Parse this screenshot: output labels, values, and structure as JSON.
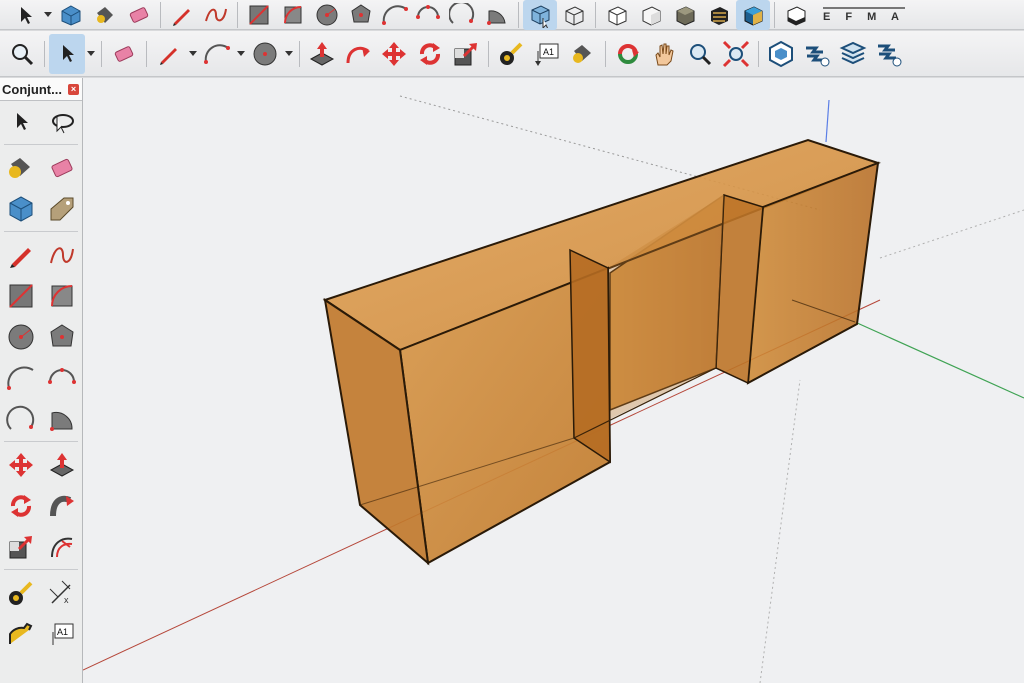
{
  "panel": {
    "title": "Conjunt...",
    "close_label": "×"
  },
  "toolbar_top": {
    "scale_label": "E F M A"
  },
  "icons_top": [
    "select-icon",
    "component-icon",
    "paint-bucket-icon",
    "eraser-icon",
    "pencil-icon",
    "freehand-icon",
    "rectangle-icon",
    "rotated-rectangle-icon",
    "circle-icon",
    "polygon-icon",
    "arc-icon",
    "two-point-arc-icon",
    "three-point-arc-icon",
    "pie-icon",
    "xray-style-icon",
    "wireframe-style-icon",
    "hidden-line-style-icon",
    "shaded-style-icon",
    "shaded-textures-style-icon",
    "monochrome-style-icon",
    "back-edges-style-icon",
    "section-plane-icon"
  ],
  "icons_second": [
    "zoom-icon",
    "select-icon",
    "eraser-icon",
    "pencil-icon",
    "arc-icon",
    "circle-icon",
    "push-pull-icon",
    "follow-me-icon",
    "move-icon",
    "rotate-icon",
    "scale-icon",
    "tape-measure-icon",
    "text-icon",
    "paint-bucket-icon",
    "orbit-icon",
    "pan-icon",
    "zoom-icon",
    "zoom-extents-icon",
    "solid-tools-icon",
    "sandbox-icon",
    "layers-icon",
    "outliner-icon"
  ],
  "panel_text_tool": "A1",
  "colors": {
    "accent": "#bcd6ee",
    "model": "#c88a3a",
    "edge": "#2a1a08"
  }
}
